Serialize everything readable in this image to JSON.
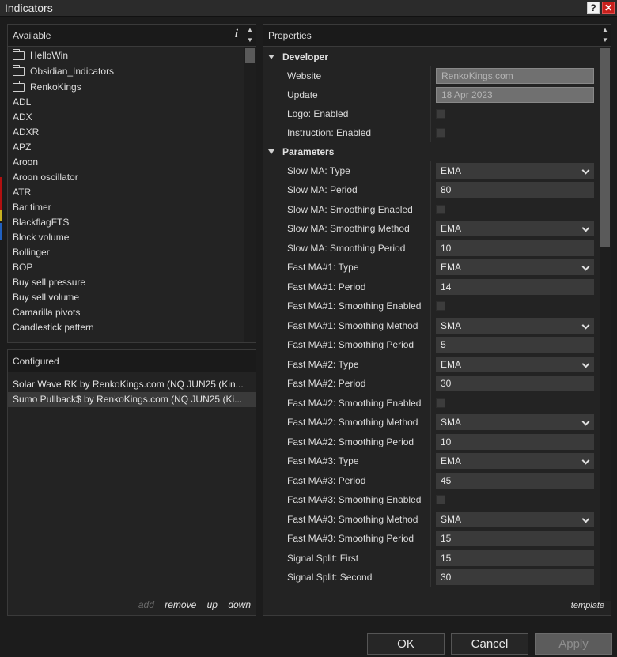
{
  "window": {
    "title": "Indicators",
    "help_label": "?",
    "close_label": "✕"
  },
  "available": {
    "header": "Available",
    "info_icon": "i",
    "folders": [
      "HelloWin",
      "Obsidian_Indicators",
      "RenkoKings"
    ],
    "items": [
      "ADL",
      "ADX",
      "ADXR",
      "APZ",
      "Aroon",
      "Aroon oscillator",
      "ATR",
      "Bar timer",
      "BlackflagFTS",
      "Block volume",
      "Bollinger",
      "BOP",
      "Buy sell pressure",
      "Buy sell volume",
      "Camarilla pivots",
      "Candlestick pattern"
    ]
  },
  "configured": {
    "header": "Configured",
    "items": [
      "Solar Wave RK by RenkoKings.com (NQ JUN25 (Kin...",
      "Sumo Pullback$ by RenkoKings.com (NQ JUN25 (Ki..."
    ],
    "selected_index": 1,
    "actions": {
      "add": "add",
      "remove": "remove",
      "up": "up",
      "down": "down"
    }
  },
  "properties": {
    "header": "Properties",
    "sections": [
      {
        "title": "Developer",
        "rows": [
          {
            "label": "Website",
            "type": "readonly",
            "value": "RenkoKings.com"
          },
          {
            "label": "Update",
            "type": "readonly",
            "value": "18 Apr 2023"
          },
          {
            "label": "Logo: Enabled",
            "type": "checkbox",
            "checked": false
          },
          {
            "label": "Instruction: Enabled",
            "type": "checkbox",
            "checked": false
          }
        ]
      },
      {
        "title": "Parameters",
        "rows": [
          {
            "label": "Slow MA: Type",
            "type": "select",
            "value": "EMA"
          },
          {
            "label": "Slow MA: Period",
            "type": "text",
            "value": "80"
          },
          {
            "label": "Slow MA: Smoothing Enabled",
            "type": "checkbox",
            "checked": false
          },
          {
            "label": "Slow MA: Smoothing Method",
            "type": "select",
            "value": "EMA"
          },
          {
            "label": "Slow MA: Smoothing Period",
            "type": "text",
            "value": "10"
          },
          {
            "label": "Fast MA#1: Type",
            "type": "select",
            "value": "EMA"
          },
          {
            "label": "Fast MA#1: Period",
            "type": "text",
            "value": "14"
          },
          {
            "label": "Fast MA#1: Smoothing Enabled",
            "type": "checkbox",
            "checked": false
          },
          {
            "label": "Fast MA#1: Smoothing Method",
            "type": "select",
            "value": "SMA"
          },
          {
            "label": "Fast MA#1: Smoothing Period",
            "type": "text",
            "value": "5"
          },
          {
            "label": "Fast MA#2: Type",
            "type": "select",
            "value": "EMA"
          },
          {
            "label": "Fast MA#2: Period",
            "type": "text",
            "value": "30"
          },
          {
            "label": "Fast MA#2: Smoothing Enabled",
            "type": "checkbox",
            "checked": false
          },
          {
            "label": "Fast MA#2: Smoothing Method",
            "type": "select",
            "value": "SMA"
          },
          {
            "label": "Fast MA#2: Smoothing Period",
            "type": "text",
            "value": "10"
          },
          {
            "label": "Fast MA#3: Type",
            "type": "select",
            "value": "EMA"
          },
          {
            "label": "Fast MA#3: Period",
            "type": "text",
            "value": "45"
          },
          {
            "label": "Fast MA#3: Smoothing Enabled",
            "type": "checkbox",
            "checked": false
          },
          {
            "label": "Fast MA#3: Smoothing Method",
            "type": "select",
            "value": "SMA"
          },
          {
            "label": "Fast MA#3: Smoothing Period",
            "type": "text",
            "value": "15"
          },
          {
            "label": "Signal Split: First",
            "type": "text",
            "value": "15"
          },
          {
            "label": "Signal Split: Second",
            "type": "text",
            "value": "30"
          }
        ]
      }
    ],
    "template_link": "template"
  },
  "buttons": {
    "ok": "OK",
    "cancel": "Cancel",
    "apply": "Apply"
  },
  "colors": {
    "background": "#1c1c1c",
    "panel": "#232323",
    "close_red": "#c8201c"
  }
}
